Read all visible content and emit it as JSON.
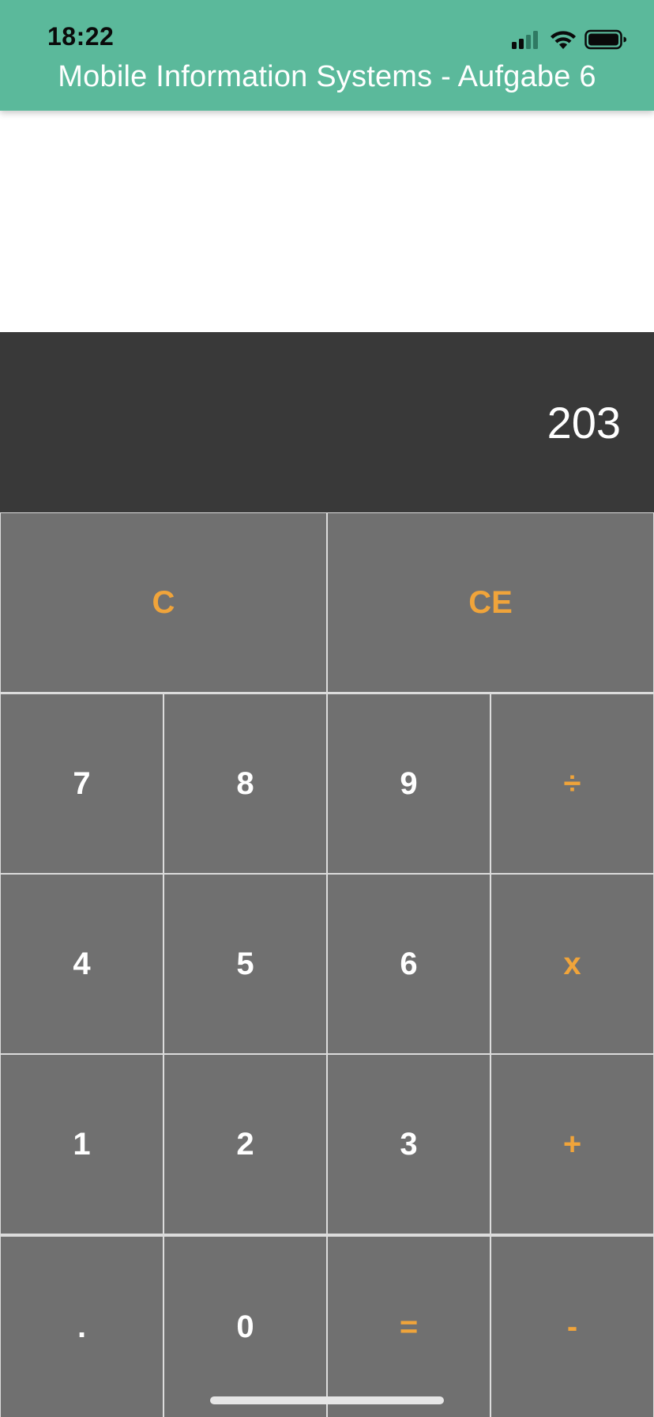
{
  "status_bar": {
    "time": "18:22",
    "icons": [
      "cellular-signal-icon",
      "wifi-icon",
      "battery-icon"
    ]
  },
  "header": {
    "title": "Mobile Information Systems - Aufgabe 6",
    "background_color": "#5bb99b"
  },
  "display": {
    "value": "203",
    "background_color": "#393939"
  },
  "keypad": {
    "digit_color": "#ffffff",
    "operator_color": "#f0a43a",
    "key_background": "#707070",
    "keys": {
      "clear": "C",
      "clear_entry": "CE",
      "seven": "7",
      "eight": "8",
      "nine": "9",
      "divide": "÷",
      "four": "4",
      "five": "5",
      "six": "6",
      "multiply": "x",
      "one": "1",
      "two": "2",
      "three": "3",
      "plus": "+",
      "decimal": ".",
      "zero": "0",
      "equals": "=",
      "minus": "-"
    }
  }
}
